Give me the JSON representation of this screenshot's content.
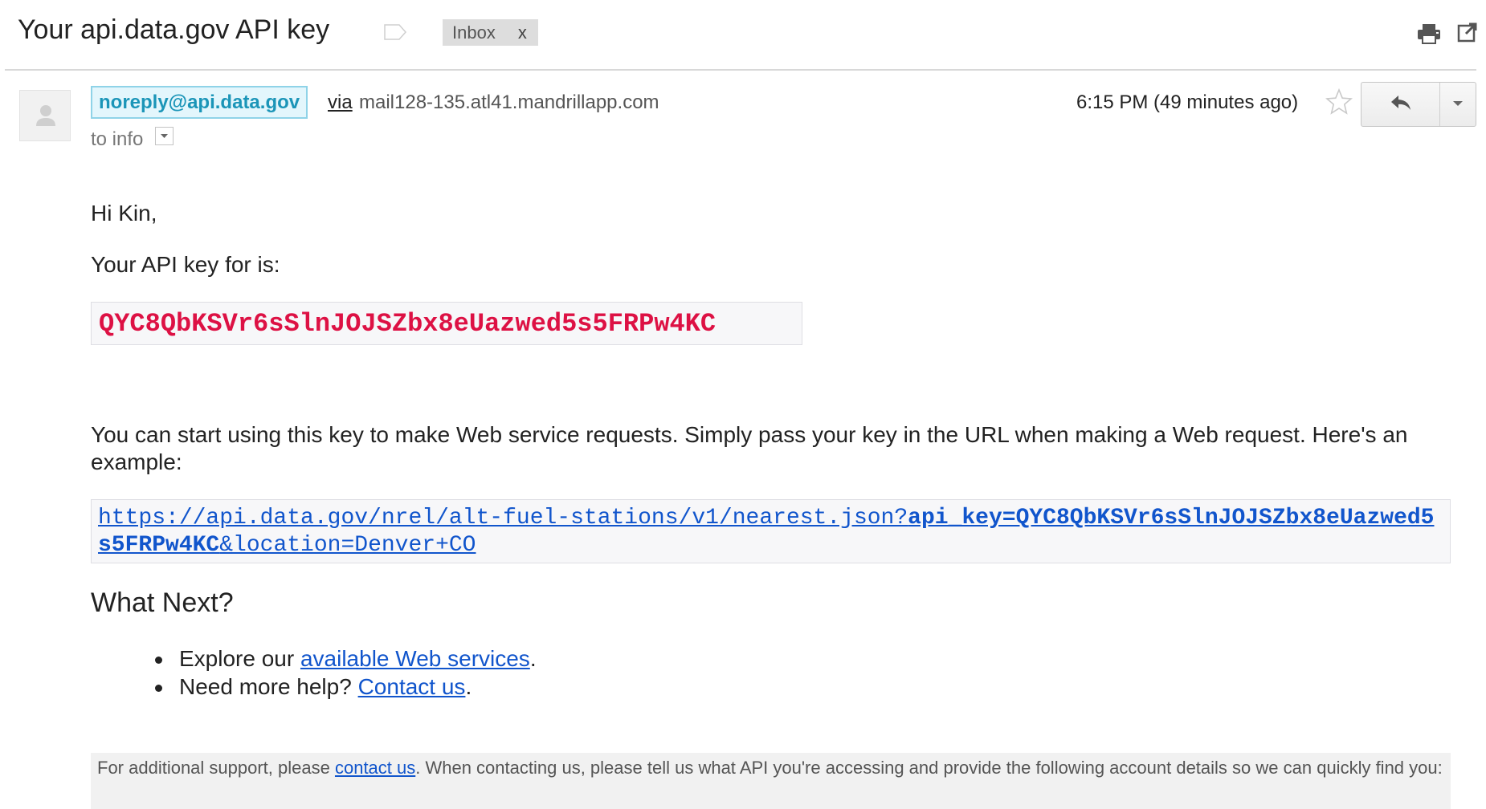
{
  "header": {
    "subject": "Your api.data.gov API key",
    "label_chip": "Inbox",
    "label_remove": "x",
    "icons": {
      "label": "label-tag-icon",
      "print": "print-icon",
      "popout": "new-window-icon"
    }
  },
  "message": {
    "sender": "noreply@api.data.gov",
    "via_label": "via",
    "relay": "mail128-135.atl41.mandrillapp.com",
    "to": "to info",
    "timestamp": "6:15 PM (49 minutes ago)",
    "icons": {
      "avatar": "avatar-icon",
      "star": "star-icon",
      "reply": "reply-icon",
      "more": "chevron-down-icon"
    }
  },
  "body": {
    "greeting": "Hi Kin,",
    "intro": "Your API key for is:",
    "api_key": "QYC8QbKSVr6sSlnJOJSZbx8eUazwed5s5FRPw4KC",
    "instructions": "You can start using this key to make Web service requests. Simply pass your key in the URL when making a Web request. Here's an example:",
    "example_url": {
      "prefix": "https://api.data.gov/nrel/alt-fuel-stations/v1/nearest.json?",
      "key_param": "api_key=QYC8QbKSVr6sSlnJOJSZbx8eUazwed5s5FRPw4KC",
      "suffix": "&location=Denver+CO"
    },
    "what_next_heading": "What Next?",
    "bullets": [
      {
        "before": "Explore our ",
        "link": "available Web services",
        "after": "."
      },
      {
        "before": "Need more help? ",
        "link": "Contact us",
        "after": "."
      }
    ],
    "support": {
      "before": "For additional support, please ",
      "link": "contact us",
      "after": ". When contacting us, please tell us what API you're accessing and provide the following account details so we can quickly find you:"
    }
  },
  "colors": {
    "accent_link": "#1155cc",
    "key_red": "#dd1144",
    "sender_teal": "#1b95b8"
  }
}
